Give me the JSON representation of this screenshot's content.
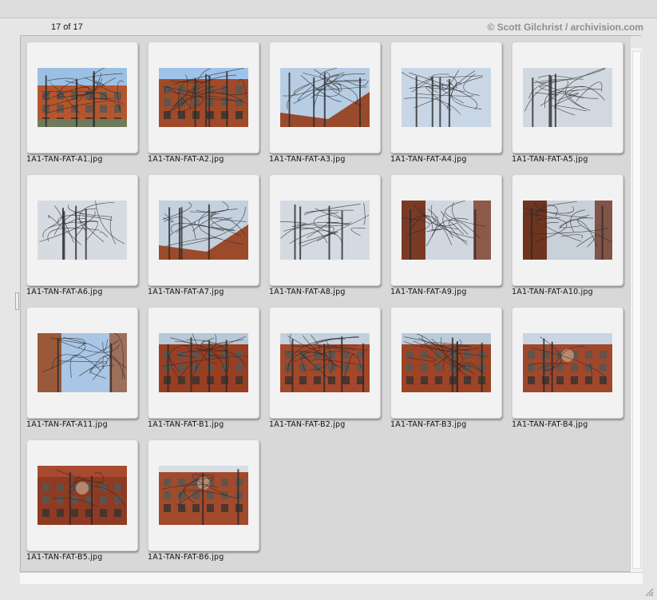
{
  "header": {
    "count": "17 of 17",
    "credit": "© Scott Gilchrist / archivision.com"
  },
  "items": [
    {
      "filename": "1A1-TAN-FAT-A1.jpg",
      "style": "street",
      "sky": "#9cc0e4",
      "accent": "#b5552e"
    },
    {
      "filename": "1A1-TAN-FAT-A2.jpg",
      "style": "facade",
      "sky": "#9ec3ea",
      "accent": "#a14a2a"
    },
    {
      "filename": "1A1-TAN-FAT-A3.jpg",
      "style": "roof",
      "sky": "#b7cde4",
      "accent": "#9a4a2c"
    },
    {
      "filename": "1A1-TAN-FAT-A4.jpg",
      "style": "wires",
      "sky": "#c9d6e6",
      "accent": "#8a4a34"
    },
    {
      "filename": "1A1-TAN-FAT-A5.jpg",
      "style": "wires",
      "sky": "#d2d8e0",
      "accent": "#7a5a44"
    },
    {
      "filename": "1A1-TAN-FAT-A6.jpg",
      "style": "wires",
      "sky": "#d6dbe2",
      "accent": "#6a5038"
    },
    {
      "filename": "1A1-TAN-FAT-A7.jpg",
      "style": "roof",
      "sky": "#c4d0de",
      "accent": "#9b4b2c"
    },
    {
      "filename": "1A1-TAN-FAT-A8.jpg",
      "style": "wires",
      "sky": "#d4dae2",
      "accent": "#6f5a48"
    },
    {
      "filename": "1A1-TAN-FAT-A9.jpg",
      "style": "wall",
      "sky": "#d0d7e0",
      "accent": "#7a3a24"
    },
    {
      "filename": "1A1-TAN-FAT-A10.jpg",
      "style": "wall",
      "sky": "#c8d0da",
      "accent": "#6e3420"
    },
    {
      "filename": "1A1-TAN-FAT-A11.jpg",
      "style": "wall",
      "sky": "#a9c6e6",
      "accent": "#9a5a3a"
    },
    {
      "filename": "1A1-TAN-FAT-B1.jpg",
      "style": "facade",
      "sky": "#b8c8d8",
      "accent": "#9a3e22"
    },
    {
      "filename": "1A1-TAN-FAT-B2.jpg",
      "style": "facade",
      "sky": "#c3d0dd",
      "accent": "#a4472a"
    },
    {
      "filename": "1A1-TAN-FAT-B3.jpg",
      "style": "facade",
      "sky": "#bccada",
      "accent": "#9e4326"
    },
    {
      "filename": "1A1-TAN-FAT-B4.jpg",
      "style": "ornament",
      "sky": "#c9d5e2",
      "accent": "#a1472c"
    },
    {
      "filename": "1A1-TAN-FAT-B5.jpg",
      "style": "ornament",
      "sky": "#a84a2e",
      "accent": "#8f3a22"
    },
    {
      "filename": "1A1-TAN-FAT-B6.jpg",
      "style": "tower",
      "sky": "#d8dee6",
      "accent": "#a24a2c"
    }
  ]
}
